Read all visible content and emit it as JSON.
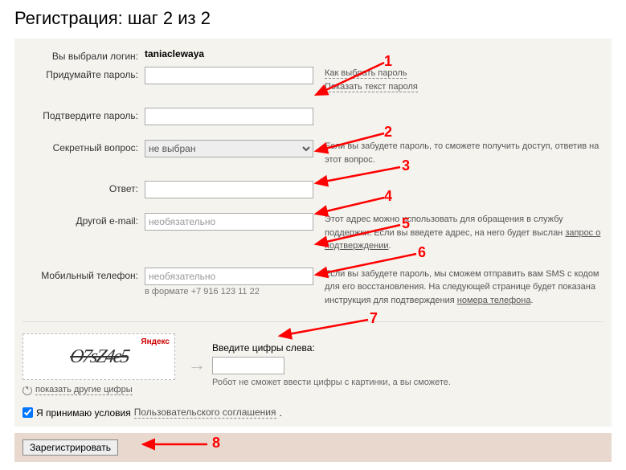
{
  "title": "Регистрация: шаг 2 из 2",
  "login_row": {
    "label": "Вы выбрали логин:",
    "value": "taniaclewaya"
  },
  "password": {
    "label": "Придумайте пароль:",
    "hint1": "Как выбрать пароль",
    "hint2": "Показать текст пароля"
  },
  "confirm": {
    "label": "Подтвердите пароль:"
  },
  "secret_q": {
    "label": "Секретный вопрос:",
    "selected": "не выбран",
    "hint": "Если вы забудете пароль, то сможете получить доступ, ответив на этот вопрос."
  },
  "answer": {
    "label": "Ответ:"
  },
  "email": {
    "label": "Другой e-mail:",
    "placeholder": "необязательно",
    "hint_pre": "Этот адрес можно использовать для обращения в службу поддержки. Если вы введете адрес, на него будет выслан ",
    "hint_link": "запрос о подтверждении",
    "hint_post": "."
  },
  "phone": {
    "label": "Мобильный телефон:",
    "placeholder": "необязательно",
    "format": "в формате +7 916 123 11 22",
    "hint_pre": "Если вы забудете пароль, мы сможем отправить вам SMS с кодом для его восстановления. На следующей странице будет показана инструкция для подтверждения ",
    "hint_link": "номера телефона",
    "hint_post": "."
  },
  "captcha": {
    "brand": "Яндекс",
    "distorted": "O7sZ4e5",
    "refresh": "показать другие цифры",
    "label": "Введите цифры слева:",
    "hint": "Робот не сможет ввести цифры с картинки, а вы сможете."
  },
  "agree": {
    "text": "Я принимаю условия ",
    "link": "Пользовательского соглашения",
    "post": "."
  },
  "submit": {
    "label": "Зарегистрировать"
  },
  "annotations": {
    "1": "1",
    "2": "2",
    "3": "3",
    "4": "4",
    "5": "5",
    "6": "6",
    "7": "7",
    "8": "8"
  }
}
